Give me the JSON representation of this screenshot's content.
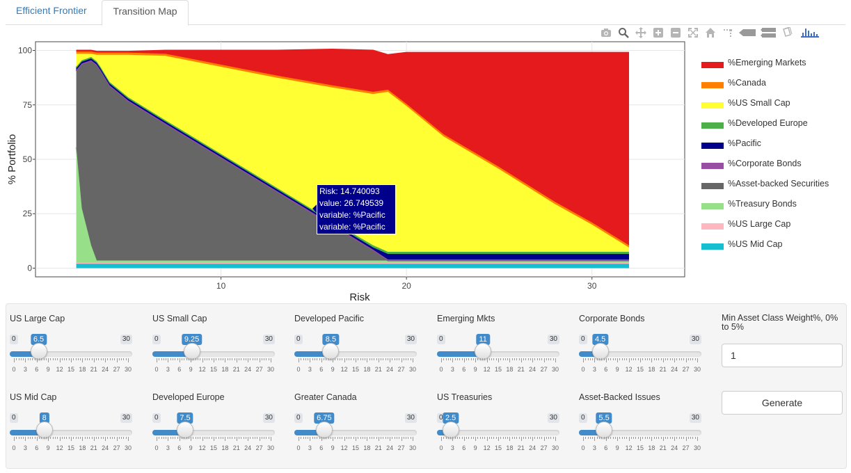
{
  "tabs": [
    {
      "label": "Efficient Frontier",
      "active": false
    },
    {
      "label": "Transition Map",
      "active": true
    }
  ],
  "modebar": [
    "camera-icon",
    "zoom-icon",
    "pan-icon",
    "zoom-in-icon",
    "zoom-out-icon",
    "autoscale-icon",
    "home-icon",
    "spike-lines-icon",
    "hover-closest-icon",
    "hover-compare-icon",
    "collaborate-icon",
    "plotly-logo-icon"
  ],
  "chart_data": {
    "type": "area",
    "xlabel": "Risk",
    "ylabel": "% Portfolio",
    "xlim": [
      0,
      35
    ],
    "ylim": [
      -4,
      104
    ],
    "x_ticks": [
      10,
      20,
      30
    ],
    "y_ticks": [
      0,
      25,
      50,
      75,
      100
    ],
    "stacked": true,
    "grid": true,
    "legend_position": "right",
    "x": [
      2.2,
      2.5,
      3.0,
      3.3,
      3.5,
      4.0,
      5.0,
      7.0,
      10.0,
      13.0,
      16.0,
      18.2,
      19.0,
      20.0,
      22.0,
      25.0,
      28.0,
      30.0,
      32.0
    ],
    "series": [
      {
        "name": "%US Mid Cap",
        "color": "#17becf",
        "values": [
          2,
          2,
          2,
          2,
          2,
          2,
          2,
          2,
          2,
          2,
          2,
          2,
          2,
          2,
          2,
          2,
          2,
          2,
          2
        ]
      },
      {
        "name": "%US Large Cap",
        "color": "#ffb6c1",
        "values": [
          0.5,
          0.5,
          0.5,
          0.5,
          0.5,
          0.5,
          0.5,
          0.5,
          0.5,
          0.5,
          0.5,
          0.5,
          0.5,
          0.5,
          0.5,
          0.5,
          0.5,
          0.5,
          0.5
        ]
      },
      {
        "name": "%Treasury Bonds",
        "color": "#98df8a",
        "values": [
          53,
          25,
          8,
          1,
          1,
          1,
          1,
          1,
          1,
          1,
          1,
          1,
          1,
          1,
          1,
          1,
          1,
          1,
          1
        ]
      },
      {
        "name": "%Asset-backed Securities",
        "color": "#666666",
        "values": [
          35,
          66,
          84.5,
          89.5,
          87,
          80,
          73,
          62.5,
          47,
          31.5,
          16,
          4.5,
          0,
          0,
          0,
          0,
          0,
          0,
          0
        ]
      },
      {
        "name": "%Corporate Bonds",
        "color": "#984ea3",
        "values": [
          0.5,
          0.5,
          0.5,
          0.5,
          0.5,
          0.5,
          0.5,
          0.5,
          0.5,
          0.5,
          0.5,
          0.5,
          0.5,
          0.5,
          0.5,
          0.5,
          0.5,
          0.5,
          0.5
        ]
      },
      {
        "name": "%Pacific",
        "color": "#00008b",
        "values": [
          0.8,
          0.8,
          0.8,
          0.8,
          0.8,
          0.8,
          0.8,
          0.8,
          0.8,
          0.8,
          0.8,
          1,
          2.5,
          2.5,
          2.5,
          2.5,
          2.5,
          2.5,
          2.5
        ]
      },
      {
        "name": "%Developed Europe",
        "color": "#4daf4a",
        "values": [
          0.7,
          0.7,
          0.7,
          0.7,
          0.7,
          0.7,
          0.7,
          0.7,
          0.7,
          0.7,
          0.7,
          1,
          1,
          1,
          1,
          1,
          1,
          1,
          1
        ]
      },
      {
        "name": "%US Small Cap",
        "color": "#ffff33",
        "values": [
          6,
          3,
          1.5,
          3,
          5.5,
          12.5,
          19.5,
          29.5,
          40,
          50.5,
          61.5,
          69.5,
          73.5,
          67,
          53,
          38,
          22,
          12.5,
          2
        ]
      },
      {
        "name": "%Canada",
        "color": "#ff7f00",
        "values": [
          1,
          1,
          1,
          1,
          1,
          1,
          1,
          1,
          1,
          1,
          1,
          1,
          1,
          1,
          1,
          1,
          1,
          1,
          1
        ]
      },
      {
        "name": "%Emerging Markets",
        "color": "#e41a1c",
        "values": [
          0.5,
          0.5,
          0.5,
          0.5,
          0.5,
          0.5,
          0.5,
          1.5,
          6.5,
          11.5,
          16.5,
          19,
          16,
          23.5,
          37.5,
          52.5,
          68.5,
          78,
          88.5
        ]
      }
    ],
    "legend_order": [
      "%Emerging Markets",
      "%Canada",
      "%US Small Cap",
      "%Developed Europe",
      "%Pacific",
      "%Corporate Bonds",
      "%Asset-backed Securities",
      "%Treasury Bonds",
      "%US Large Cap",
      "%US Mid Cap"
    ],
    "hover": {
      "lines": [
        "Risk: 14.740093",
        "value:  26.749539",
        "variable: %Pacific",
        "variable: %Pacific"
      ],
      "color": "#00008b"
    }
  },
  "sliders": [
    {
      "label": "US Large Cap",
      "min": 0,
      "max": 30,
      "value": 6.5,
      "display": "6.5"
    },
    {
      "label": "US Small Cap",
      "min": 0,
      "max": 30,
      "value": 9.25,
      "display": "9.25"
    },
    {
      "label": "Developed Pacific",
      "min": 0,
      "max": 30,
      "value": 8.5,
      "display": "8.5"
    },
    {
      "label": "Emerging Mkts",
      "min": 0,
      "max": 30,
      "value": 11,
      "display": "11"
    },
    {
      "label": "Corporate Bonds",
      "min": 0,
      "max": 30,
      "value": 4.5,
      "display": "4.5"
    },
    {
      "label": "US Mid Cap",
      "min": 0,
      "max": 30,
      "value": 8,
      "display": "8"
    },
    {
      "label": "Developed Europe",
      "min": 0,
      "max": 30,
      "value": 7.5,
      "display": "7.5"
    },
    {
      "label": "Greater Canada",
      "min": 0,
      "max": 30,
      "value": 6.75,
      "display": "6.75"
    },
    {
      "label": "US Treasuries",
      "min": 0,
      "max": 30,
      "value": 2.5,
      "display": "2.5"
    },
    {
      "label": "Asset-Backed Issues",
      "min": 0,
      "max": 30,
      "value": 5.5,
      "display": "5.5"
    }
  ],
  "slider_ticks": [
    "0",
    "3",
    "6",
    "9",
    "12",
    "15",
    "18",
    "21",
    "24",
    "27",
    "30"
  ],
  "min_weight": {
    "label": "Min Asset Class Weight%, 0% to 5%",
    "value": "1"
  },
  "generate_label": "Generate"
}
